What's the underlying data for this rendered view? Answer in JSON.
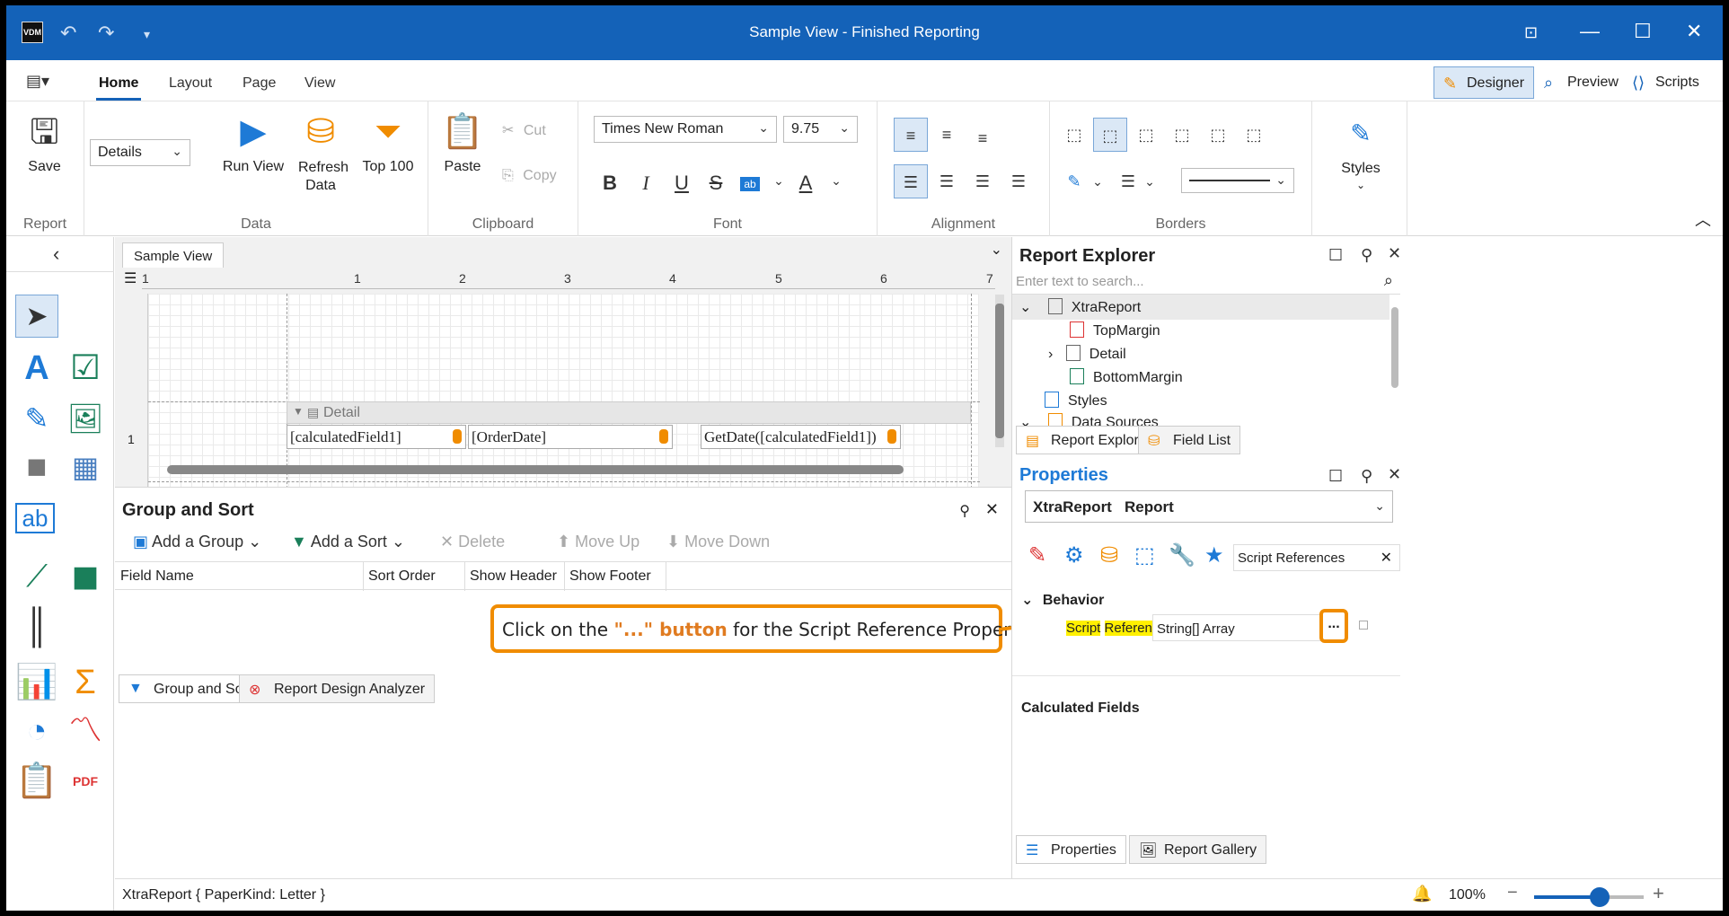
{
  "window": {
    "title": "Sample View - Finished Reporting",
    "app_icon": "VDM"
  },
  "tabs": [
    "Home",
    "Layout",
    "Page",
    "View"
  ],
  "modes": {
    "designer": "Designer",
    "preview": "Preview",
    "scripts": "Scripts"
  },
  "ribbon": {
    "report": {
      "save": "Save",
      "group": "Report"
    },
    "data": {
      "band_select": "Details",
      "run_view": "Run View",
      "refresh_data": "Refresh Data",
      "top100": "Top 100",
      "group": "Data"
    },
    "clipboard": {
      "paste": "Paste",
      "cut": "Cut",
      "copy": "Copy",
      "group": "Clipboard"
    },
    "font": {
      "family": "Times New Roman",
      "size": "9.75",
      "group": "Font"
    },
    "alignment": {
      "group": "Alignment"
    },
    "borders": {
      "group": "Borders"
    },
    "styles": {
      "label": "Styles"
    }
  },
  "designer": {
    "doc_tab": "Sample View",
    "ruler": [
      "1",
      "1",
      "2",
      "3",
      "4",
      "5",
      "6",
      "7"
    ],
    "band_marker": "1",
    "detail_band": "Detail",
    "labels": [
      "[calculatedField1]",
      "[OrderDate]",
      "GetDate([calculatedField1])"
    ]
  },
  "group_sort": {
    "title": "Group and Sort",
    "add_group": "Add a Group",
    "add_sort": "Add a Sort",
    "delete": "Delete",
    "move_up": "Move Up",
    "move_down": "Move Down",
    "columns": [
      "Field Name",
      "Sort Order",
      "Show Header",
      "Show Footer"
    ]
  },
  "callout": {
    "prefix": "Click on the ",
    "emphasis": "\"...\" button",
    "suffix": " for the Script Reference Property"
  },
  "bottom_tabs": {
    "group_sort": "Group and Sort",
    "analyzer": "Report Design Analyzer"
  },
  "status": {
    "text": "XtraReport { PaperKind: Letter }",
    "zoom": "100%",
    "zoom_level": 0.6
  },
  "explorer": {
    "title": "Report Explorer",
    "search_placeholder": "Enter text to search...",
    "tree": [
      "XtraReport",
      "TopMargin",
      "Detail",
      "BottomMargin",
      "Styles",
      "Data Sources"
    ],
    "tab_explorer": "Report Explorer",
    "tab_fields": "Field List"
  },
  "properties": {
    "title": "Properties",
    "object": "XtraReport",
    "object_type": "Report",
    "search_value": "Script References",
    "category": "Behavior",
    "prop_name_1": "Script",
    "prop_name_2": "References",
    "prop_value": "String[] Array",
    "ellipsis": "...",
    "calculated_fields": "Calculated Fields",
    "tab_properties": "Properties",
    "tab_gallery": "Report Gallery"
  },
  "colors": {
    "titlebar": "#1462b8",
    "accent": "#1462b8",
    "callout": "#f08c00",
    "highlight": "#fff000"
  }
}
